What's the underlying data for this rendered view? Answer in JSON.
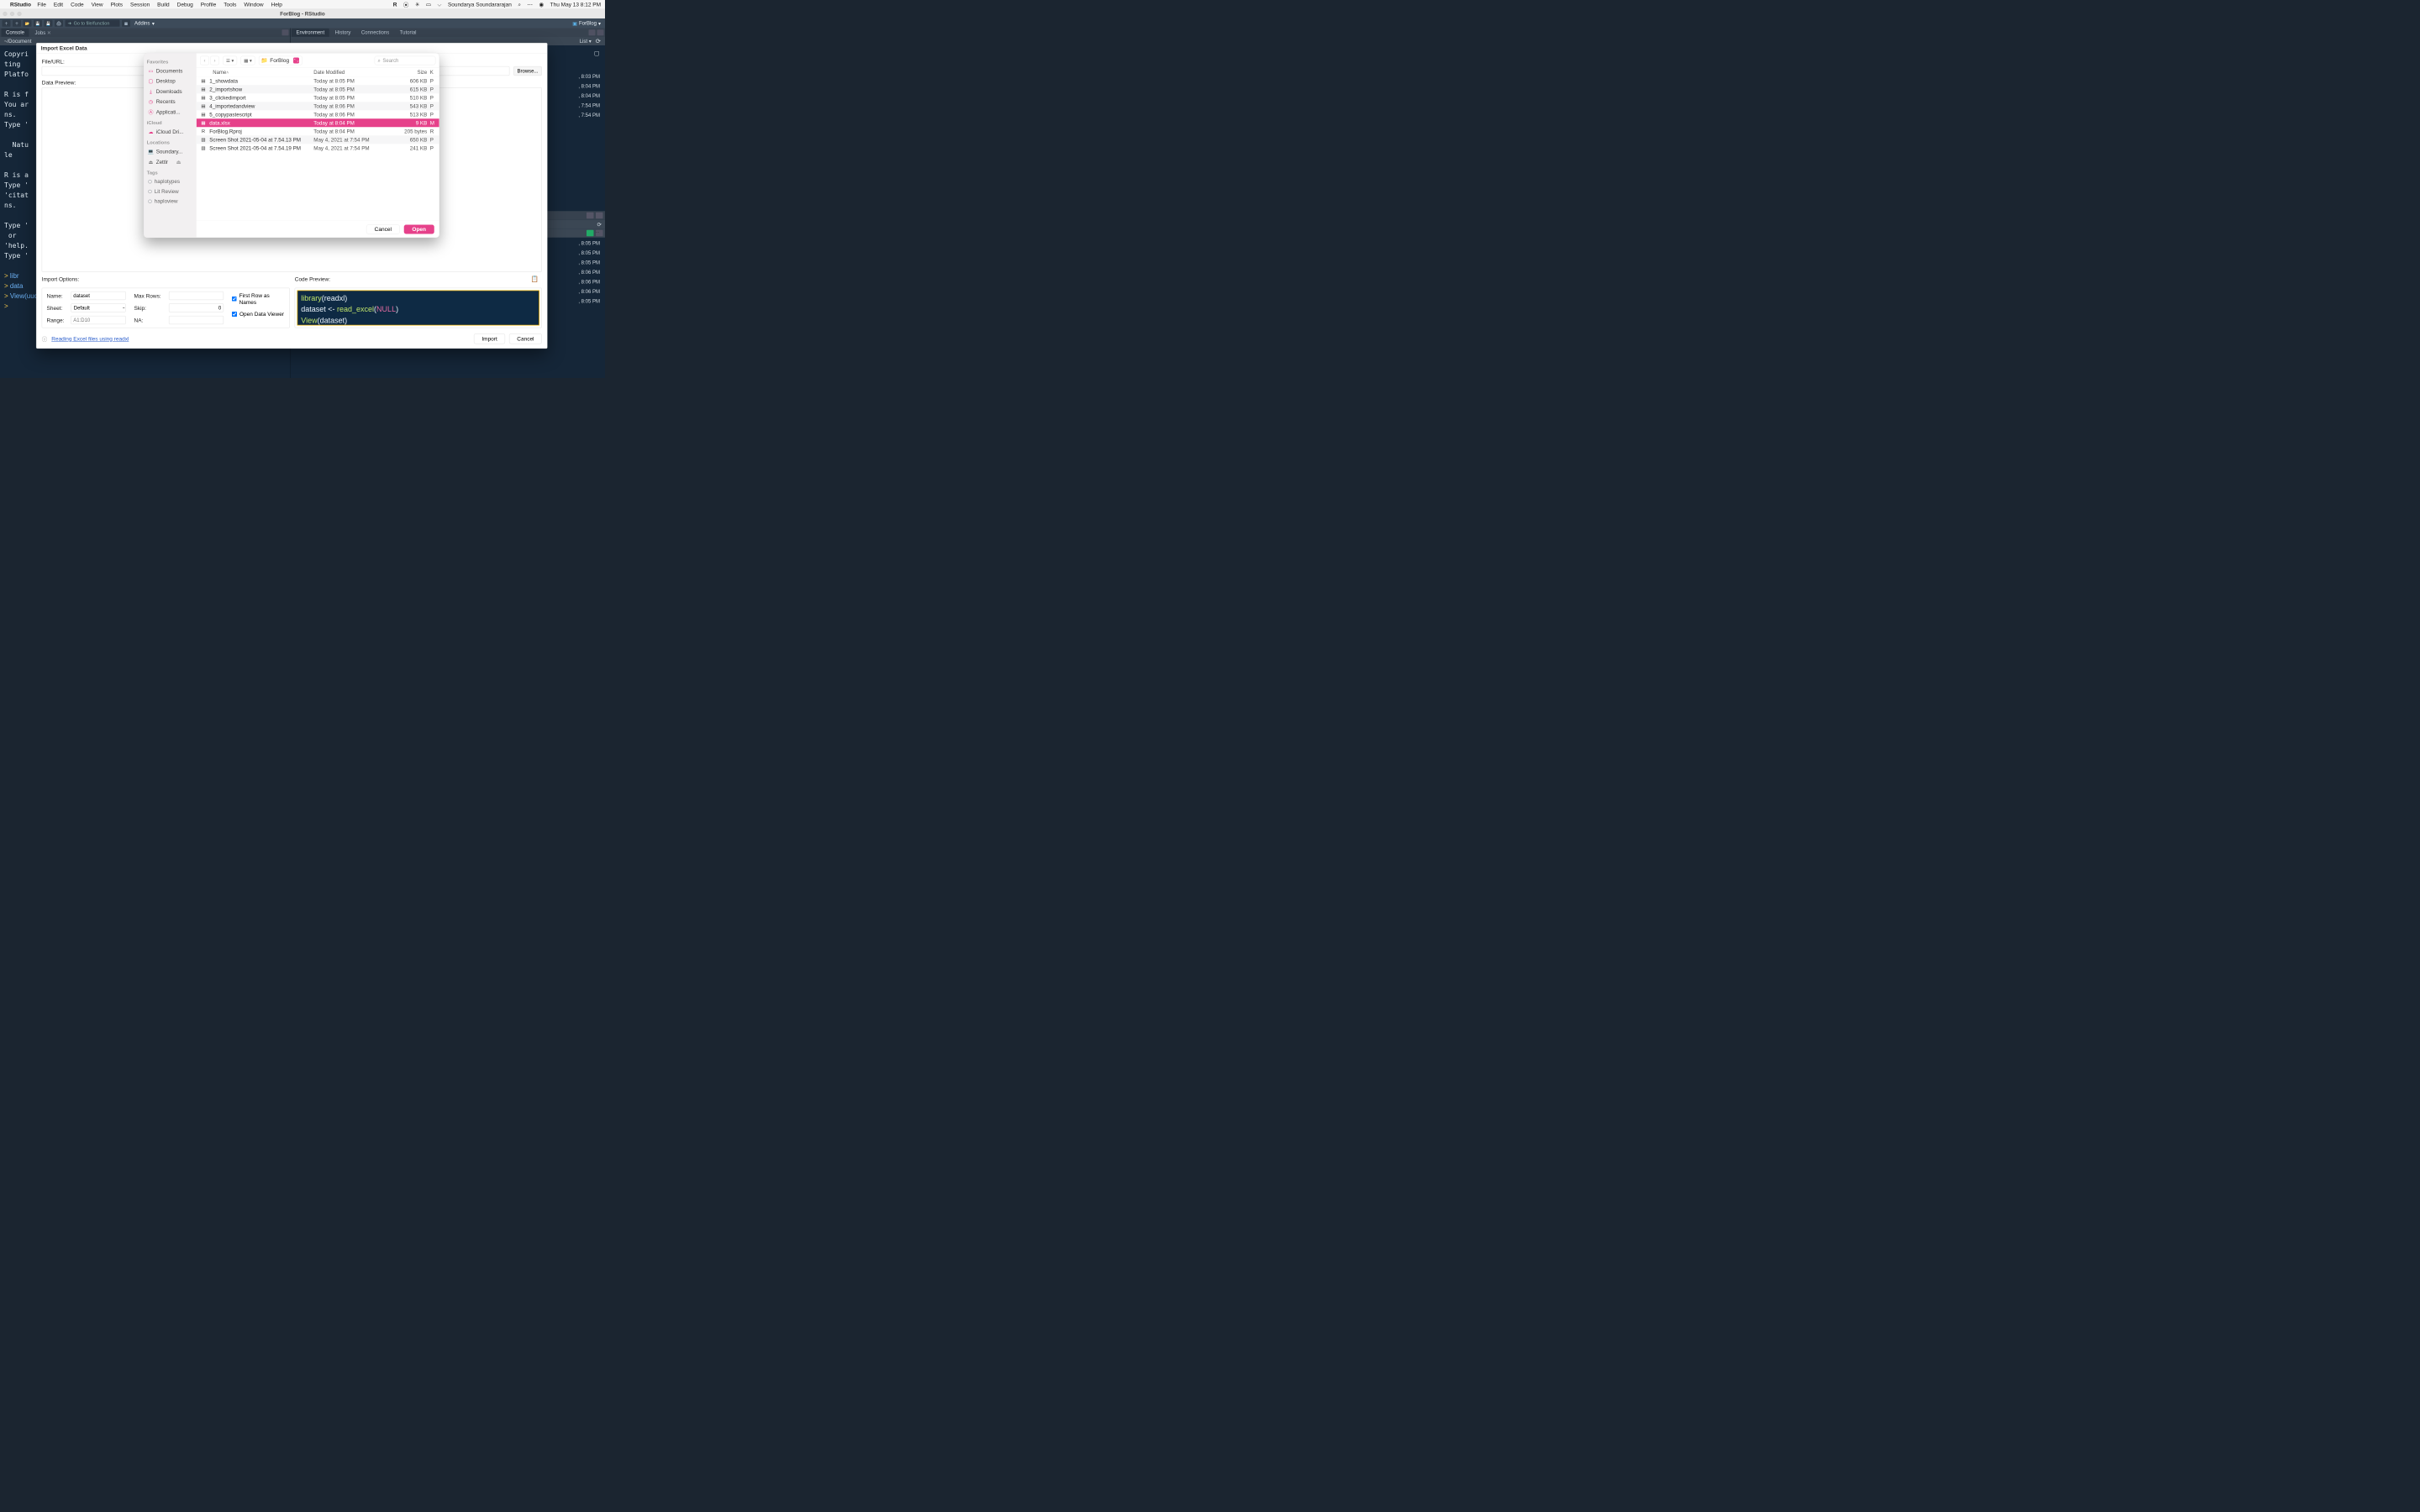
{
  "menubar": {
    "app": "RStudio",
    "items": [
      "File",
      "Edit",
      "Code",
      "View",
      "Plots",
      "Session",
      "Build",
      "Debug",
      "Profile",
      "Tools",
      "Window",
      "Help"
    ],
    "user": "Soundarya Soundararajan",
    "clock": "Thu May 13  8:12 PM"
  },
  "window": {
    "title": "ForBlog - RStudio"
  },
  "toolbar": {
    "goto": "Go to file/function",
    "addins": "Addins",
    "project": "ForBlog"
  },
  "left_tabs": {
    "a": "Console",
    "b": "Jobs"
  },
  "pathbar": "~/Document",
  "console_lines": [
    "Copyri",
    "ting",
    "Platfo",
    "",
    "R is f",
    "You ar",
    "ns.",
    "Type '",
    "",
    "  Natu",
    "le",
    "",
    "R is a",
    "Type '",
    "'citat",
    "ns.",
    "",
    "Type '",
    " or",
    "'help.",
    "Type '"
  ],
  "console_cmds": [
    "libr",
    "data",
    "View(uucu)"
  ],
  "right_tabs": {
    "a": "Environment",
    "b": "History",
    "c": "Connections",
    "d": "Tutorial",
    "listbtn": "List"
  },
  "right_times": [
    ", 8:03 PM",
    ", 8:04 PM",
    ", 8:04 PM",
    ", 7:54 PM",
    ", 7:54 PM",
    ", 8:05 PM",
    ", 8:05 PM",
    ", 8:05 PM",
    ", 8:06 PM",
    ", 8:06 PM",
    ", 8:06 PM",
    ", 8:05 PM"
  ],
  "dialog": {
    "title": "Import Excel Data",
    "file_label": "File/URL:",
    "browse": "Browse...",
    "preview_label": "Data Preview:",
    "options_label": "Import Options:",
    "code_label": "Code Preview:",
    "name_label": "Name:",
    "name_value": "dataset",
    "sheet_label": "Sheet:",
    "sheet_value": "Default",
    "range_label": "Range:",
    "range_placeholder": "A1:D10",
    "maxrows_label": "Max Rows:",
    "skip_label": "Skip:",
    "skip_value": "0",
    "na_label": "NA:",
    "firstrow": "First Row as Names",
    "opendv": "Open Data Viewer",
    "help": "Reading Excel files using readxl",
    "import": "Import",
    "cancel": "Cancel",
    "code": {
      "l1a": "library",
      "l1b": "(readxl)",
      "l2a": "dataset <- ",
      "l2b": "read_excel",
      "l2c": "(",
      "l2d": "NULL",
      "l2e": ")",
      "l3a": "View",
      "l3b": "(dataset)"
    }
  },
  "finder": {
    "favorites_head": "Favorites",
    "favorites": [
      "Documents",
      "Desktop",
      "Downloads",
      "Recents",
      "Applicati..."
    ],
    "icloud_head": "iCloud",
    "icloud": [
      "iCloud Dri..."
    ],
    "locations_head": "Locations",
    "locations": [
      "Soundary...",
      "Zettlr"
    ],
    "tags_head": "Tags",
    "tags": [
      "haplotypes",
      "Lit Review",
      "haploview"
    ],
    "location_name": "ForBlog",
    "search_placeholder": "Search",
    "col_name": "Name",
    "col_date": "Date Modified",
    "col_size": "Size",
    "col_kind": "K",
    "cancel": "Cancel",
    "open": "Open",
    "rows": [
      {
        "icon": "▤",
        "name": "1_showdata",
        "date": "Today at 8:05 PM",
        "size": "606 KB",
        "kind": "P"
      },
      {
        "icon": "▤",
        "name": "2_importshow",
        "date": "Today at 8:05 PM",
        "size": "615 KB",
        "kind": "P"
      },
      {
        "icon": "▤",
        "name": "3_clickedimport",
        "date": "Today at 8:05 PM",
        "size": "510 KB",
        "kind": "P"
      },
      {
        "icon": "▤",
        "name": "4_importedandview",
        "date": "Today at 8:06 PM",
        "size": "543 KB",
        "kind": "P"
      },
      {
        "icon": "▤",
        "name": "5_copypastescript",
        "date": "Today at 8:06 PM",
        "size": "513 KB",
        "kind": "P"
      },
      {
        "icon": "▦",
        "name": "data.xlsx",
        "date": "Today at 8:04 PM",
        "size": "9 KB",
        "kind": "M",
        "selected": true
      },
      {
        "icon": "R",
        "name": "ForBlog.Rproj",
        "date": "Today at 8:04 PM",
        "size": "205 bytes",
        "kind": "R"
      },
      {
        "icon": "▧",
        "name": "Screen Shot 2021-05-04 at 7.54.13 PM",
        "date": "May 4, 2021 at 7:54 PM",
        "size": "650 KB",
        "kind": "P"
      },
      {
        "icon": "▧",
        "name": "Screen Shot 2021-05-04 at 7.54.19 PM",
        "date": "May 4, 2021 at 7:54 PM",
        "size": "241 KB",
        "kind": "P"
      }
    ]
  }
}
